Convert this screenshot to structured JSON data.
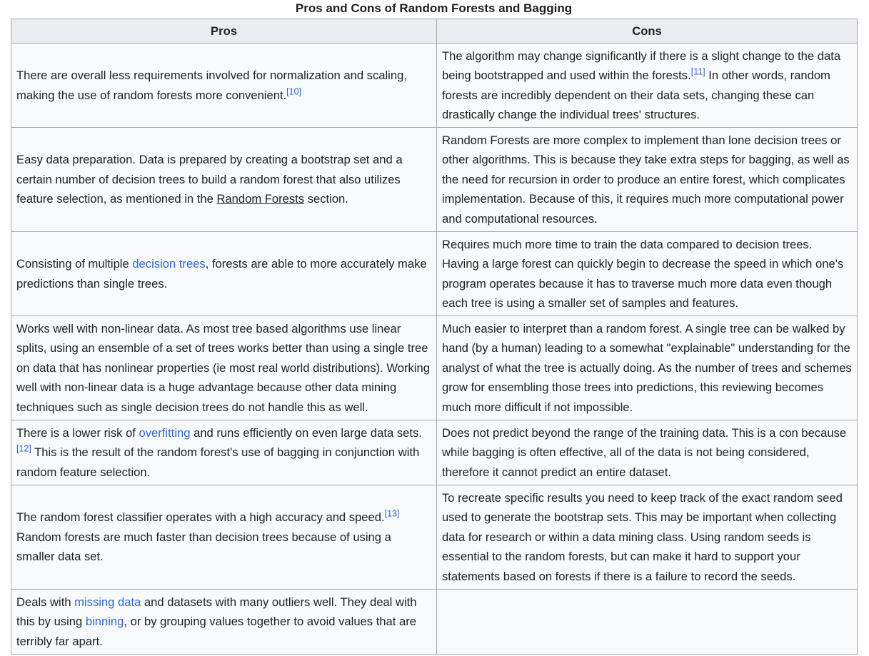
{
  "caption": "Pros and Cons of Random Forests and Bagging",
  "headers": {
    "pros": "Pros",
    "cons": "Cons"
  },
  "rows": [
    {
      "pros": {
        "t1": "There are overall less requirements involved for normalization and scaling, making the use of random forests more convenient.",
        "ref1": "[10]"
      },
      "cons": {
        "t1": "The algorithm may change significantly if there is a slight change to the data being bootstrapped and used within the forests.",
        "ref1": "[11]",
        "t2": " In other words, random forests are incredibly dependent on their data sets, changing these can drastically change the individual trees' structures."
      }
    },
    {
      "pros": {
        "t1": "Easy data preparation. Data is prepared by creating a bootstrap set and a certain number of decision trees to build a random forest that also utilizes feature selection, as mentioned in the ",
        "link1": "Random Forests",
        "t2": " section."
      },
      "cons": {
        "t1": "Random Forests are more complex to implement than lone decision trees or other algorithms. This is because they take extra steps for bagging, as well as the need for recursion in order to produce an entire forest, which complicates implementation. Because of this, it requires much more computational power and computational resources."
      }
    },
    {
      "pros": {
        "t1": "Consisting of multiple ",
        "link1": "decision trees",
        "t2": ", forests are able to more accurately make predictions than single trees."
      },
      "cons": {
        "t1": "Requires much more time to train the data compared to decision trees. Having a large forest can quickly begin to decrease the speed in which one's program operates because it has to traverse much more data even though each tree is using a smaller set of samples and features."
      }
    },
    {
      "pros": {
        "t1": "Works well with non-linear data. As most tree based algorithms use linear splits, using an ensemble of a set of trees works better than using a single tree on data that has nonlinear properties (ie most real world distributions). Working well with non-linear data is a huge advantage because other data mining techniques such as single decision trees do not handle this as well."
      },
      "cons": {
        "t1": "Much easier to interpret than a random forest. A single tree can be walked by hand (by a human) leading to a somewhat \"explainable\" understanding for the analyst of what the tree is actually doing. As the number of trees and schemes grow for ensembling those trees into predictions, this reviewing becomes much more difficult if not impossible."
      }
    },
    {
      "pros": {
        "t1": "There is a lower risk of ",
        "link1": "overfitting",
        "t2": " and runs efficiently on even large data sets.",
        "ref1": "[12]",
        "t3": " This is the result of the random forest's use of bagging in conjunction with random feature selection."
      },
      "cons": {
        "t1": "Does not predict beyond the range of the training data. This is a con because while bagging is often effective, all of the data is not being considered, therefore it cannot predict an entire dataset."
      }
    },
    {
      "pros": {
        "t1": "The random forest classifier operates with a high accuracy and speed.",
        "ref1": "[13]",
        "t2": " Random forests are much faster than decision trees because of using a smaller data set."
      },
      "cons": {
        "t1": "To recreate specific results you need to keep track of the exact random seed used to generate the bootstrap sets. This may be important when collecting data for research or within a data mining class. Using random seeds is essential to the random forests, but can make it hard to support your statements based on forests if there is a failure to record the seeds."
      }
    },
    {
      "pros": {
        "t1": "Deals with ",
        "link1": "missing data",
        "t2": " and datasets with many outliers well. They deal with this by using ",
        "link2": "binning",
        "t3": ", or by grouping values together to avoid values that are terribly far apart."
      },
      "cons": {
        "t1": ""
      }
    }
  ],
  "colors": {
    "link": "#3366cc",
    "text": "#202122",
    "cell_bg": "#f8f9fa",
    "header_bg": "#eaecf0",
    "border": "#a2a9b1"
  }
}
